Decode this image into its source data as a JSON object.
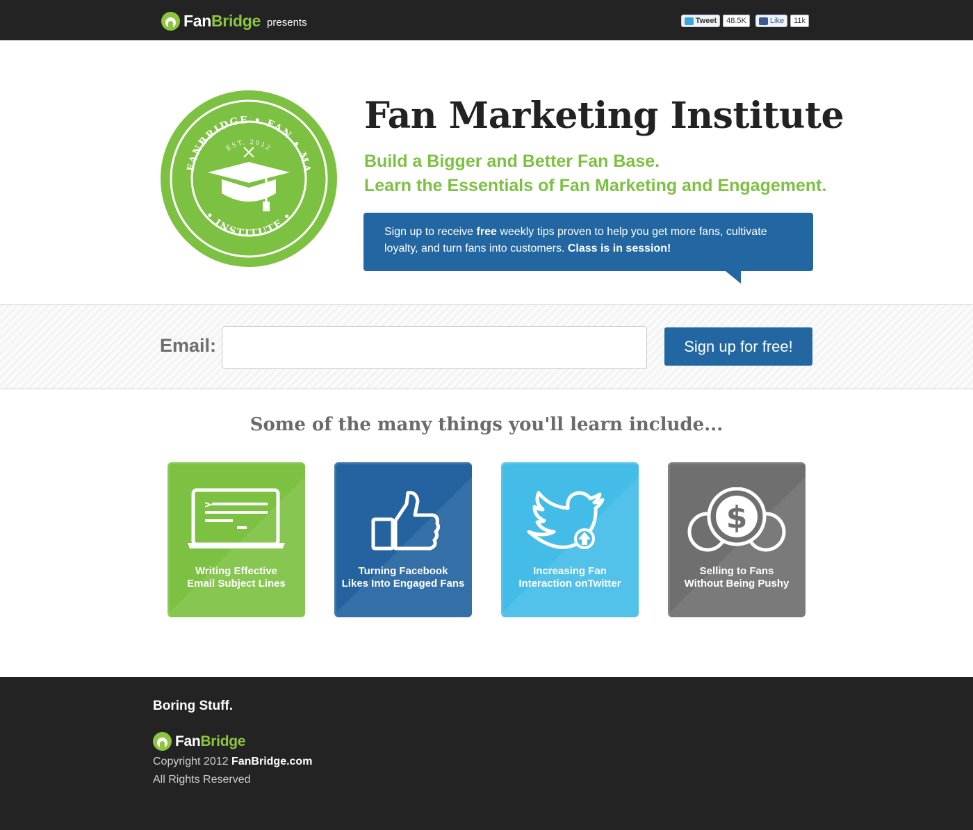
{
  "topbar": {
    "brand_fan": "Fan",
    "brand_bridge": "Bridge",
    "presents": "presents",
    "tweet_label": "Tweet",
    "tweet_count": "48.5K",
    "like_label": "Like",
    "like_count": "11k"
  },
  "badge": {
    "arc_top": "FAN",
    "arc_right": "MARKETING",
    "arc_bottom": "INSTITUTE",
    "arc_left": "FANBRIDGE",
    "est": "EST. 2012"
  },
  "hero": {
    "title": "Fan Marketing Institute",
    "subtitle_line1": "Build a Bigger and Better Fan Base.",
    "subtitle_line2": "Learn the Essentials of Fan Marketing and Engagement.",
    "callout_part1": "Sign up to receive ",
    "callout_bold1": "free",
    "callout_part2": " weekly tips proven to help you get more fans, cultivate loyalty, and turn fans into customers. ",
    "callout_bold2": "Class is in session!"
  },
  "signup": {
    "email_label": "Email:",
    "email_value": "",
    "email_placeholder": "",
    "button_label": "Sign up for free!"
  },
  "learn": {
    "heading": "Some of the many things you'll learn include...",
    "cards": [
      {
        "line1": "Writing Effective",
        "line2": "Email Subject Lines",
        "icon": "laptop-icon",
        "color": "#7dc142"
      },
      {
        "line1": "Turning Facebook",
        "line2": "Likes Into Engaged Fans",
        "icon": "thumbs-up-icon",
        "color": "#2463a0"
      },
      {
        "line1": "Increasing Fan",
        "line2": "Interaction onTwitter",
        "icon": "twitter-bird-icon",
        "color": "#43bde8"
      },
      {
        "line1": "Selling to Fans",
        "line2": "Without Being Pushy",
        "icon": "coins-icon",
        "color": "#6f6f6f"
      }
    ]
  },
  "footer": {
    "heading": "Boring Stuff.",
    "brand_fan": "Fan",
    "brand_bridge": "Bridge",
    "copyright_prefix": "Copyright 2012 ",
    "copyright_site": "FanBridge.com",
    "rights": "All Rights Reserved"
  },
  "colors": {
    "brand_green": "#8cc63f",
    "accent_blue": "#2267a2",
    "topbar_bg": "#232323"
  }
}
